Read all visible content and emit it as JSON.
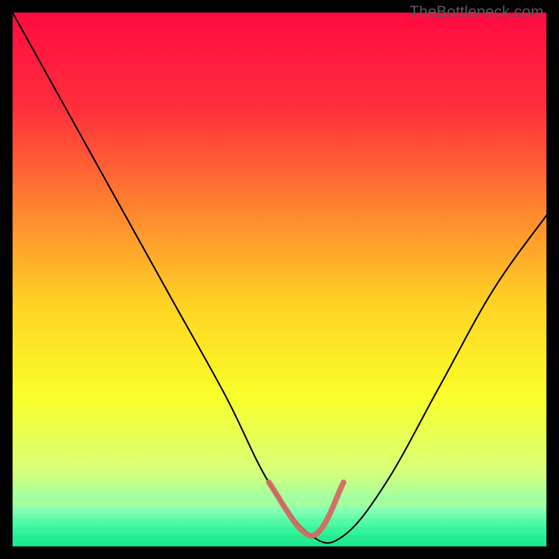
{
  "watermark": "TheBottleneck.com",
  "chart_data": {
    "type": "line",
    "title": "",
    "xlabel": "",
    "ylabel": "",
    "xlim": [
      0,
      100
    ],
    "ylim": [
      0,
      100
    ],
    "grid": false,
    "series": [
      {
        "name": "bottleneck-curve",
        "x": [
          0,
          10,
          20,
          30,
          40,
          48,
          56,
          62,
          70,
          80,
          90,
          100
        ],
        "y": [
          100,
          82,
          64,
          46,
          28,
          12,
          2,
          2,
          12,
          30,
          48,
          62
        ]
      },
      {
        "name": "highlight-segment",
        "x": [
          48,
          56,
          62
        ],
        "y": [
          12,
          2,
          12
        ]
      }
    ],
    "gradient_colors": [
      {
        "stop": 0.0,
        "hex": "#ff0a41"
      },
      {
        "stop": 0.18,
        "hex": "#ff2f3b"
      },
      {
        "stop": 0.38,
        "hex": "#ff8a2f"
      },
      {
        "stop": 0.55,
        "hex": "#ffd423"
      },
      {
        "stop": 0.72,
        "hex": "#f9ff2a"
      },
      {
        "stop": 0.86,
        "hex": "#d7ff7a"
      },
      {
        "stop": 0.93,
        "hex": "#8cffb0"
      },
      {
        "stop": 0.97,
        "hex": "#34f7a0"
      },
      {
        "stop": 1.0,
        "hex": "#14e78a"
      }
    ]
  }
}
